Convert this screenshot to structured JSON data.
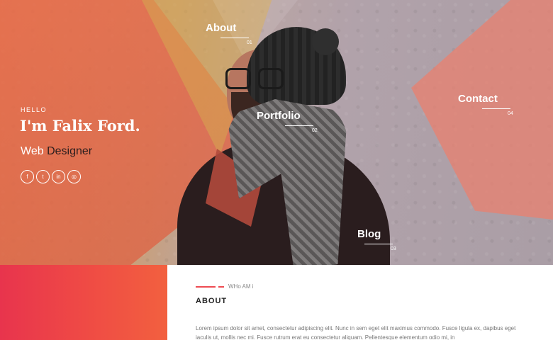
{
  "hero": {
    "greeting": "HELLO",
    "name": "I'm Falix Ford.",
    "role_part1": "Web",
    "role_part2": "Designer",
    "socials": [
      {
        "icon": "facebook-icon",
        "glyph": "f"
      },
      {
        "icon": "twitter-icon",
        "glyph": "t"
      },
      {
        "icon": "linkedin-icon",
        "glyph": "in"
      },
      {
        "icon": "dribbble-icon",
        "glyph": "◎"
      }
    ]
  },
  "menu": {
    "about": {
      "label": "About",
      "number": "01"
    },
    "portfolio": {
      "label": "Portfolio",
      "number": "02"
    },
    "blog": {
      "label": "Blog",
      "number": "03"
    },
    "contact": {
      "label": "Contact",
      "number": "04"
    }
  },
  "about_section": {
    "eyebrow": "WHo AM i",
    "title": "ABOUT",
    "body": "Lorem ipsum dolor sit amet, consectetur adipiscing elit. Nunc in sem eget elit maximus commodo. Fusce ligula ex, dapibus eget iaculis ut, mollis nec mi. Fusce rutrum erat eu consectetur aliquam. Pellentesque elementum odio mi, in"
  },
  "colors": {
    "accent": "#ee4b52",
    "gradient_start": "#e8344d",
    "gradient_end": "#f2603f"
  }
}
